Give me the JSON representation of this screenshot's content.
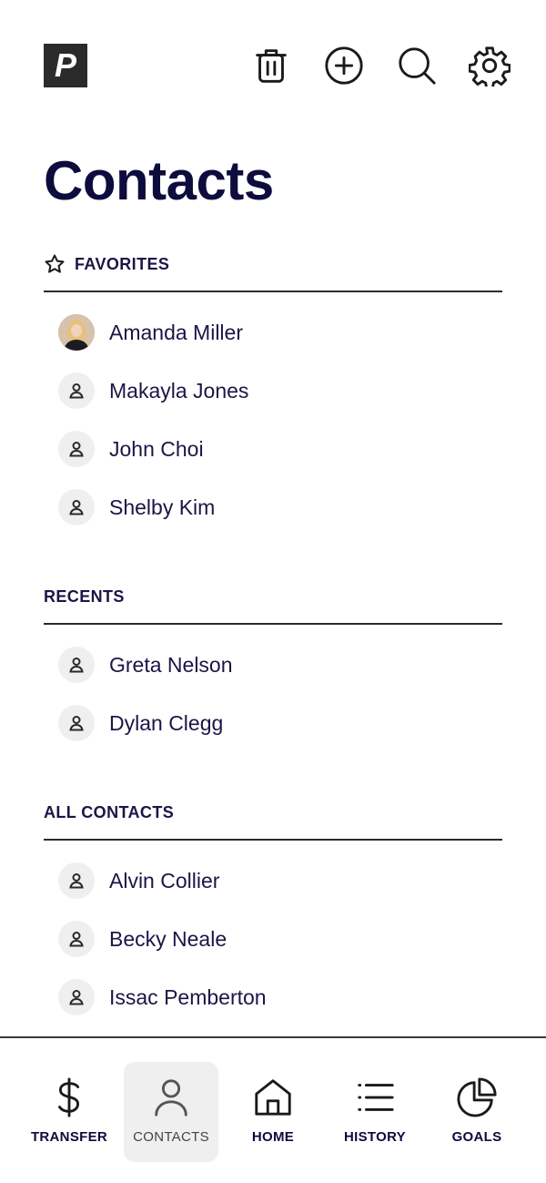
{
  "app": {
    "logo_letter": "P"
  },
  "toolbar": {
    "buttons": [
      {
        "icon": "trash-icon"
      },
      {
        "icon": "add-circle-icon"
      },
      {
        "icon": "search-icon"
      },
      {
        "icon": "gear-icon"
      }
    ]
  },
  "page": {
    "title": "Contacts"
  },
  "sections": {
    "favorites": {
      "title": "FAVORITES",
      "icon": "star-outline-icon",
      "contacts": [
        "Amanda Miller",
        "Makayla Jones",
        "John Choi",
        "Shelby Kim"
      ]
    },
    "recents": {
      "title": "RECENTS",
      "contacts": [
        "Greta Nelson",
        "Dylan Clegg"
      ]
    },
    "all": {
      "title": "ALL CONTACTS",
      "contacts": [
        "Alvin Collier",
        "Becky Neale",
        "Issac Pemberton"
      ]
    }
  },
  "bottom_nav": {
    "items": [
      {
        "label": "TRANSFER",
        "icon": "dollar-icon"
      },
      {
        "label": "CONTACTS",
        "icon": "person-icon",
        "active": true
      },
      {
        "label": "HOME",
        "icon": "home-icon"
      },
      {
        "label": "HISTORY",
        "icon": "list-icon"
      },
      {
        "label": "GOALS",
        "icon": "pie-chart-icon"
      }
    ]
  },
  "colors": {
    "title": "#0e0b3d",
    "text": "#1a1646",
    "avatar_bg": "#efefef",
    "active_nav_bg": "#efefef"
  }
}
